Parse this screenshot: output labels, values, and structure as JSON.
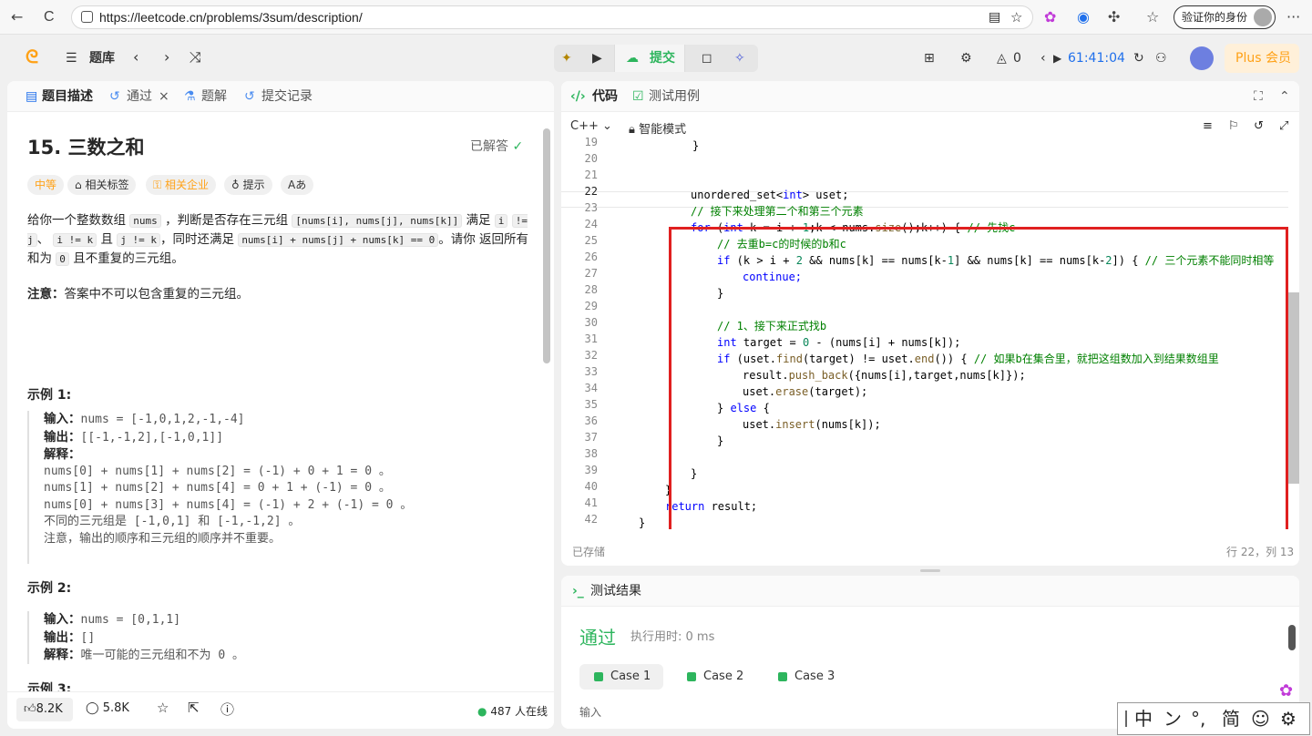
{
  "browser": {
    "url": "https://leetcode.cn/problems/3sum/description/",
    "verify_label": "验证你的身份",
    "back_icon": "←",
    "refresh_icon": "C",
    "more_icon": "···"
  },
  "header": {
    "problemset_label": "题库",
    "submit_label": "提交",
    "fire_count": "0",
    "timer": "61:41:04",
    "plus_label": "Plus 会员"
  },
  "left_tabs": [
    "题目描述",
    "通过",
    "题解",
    "提交记录"
  ],
  "problem": {
    "title": "15. 三数之和",
    "solved_label": "已解答",
    "difficulty": "中等",
    "tags_label": "相关标签",
    "company_label": "相关企业",
    "hint_label": "提示",
    "font_label": "Aあ",
    "desc_l1_a": "给你一个整数数组",
    "desc_code_nums": "nums",
    "desc_l1_b": "，判断是否存在三元组",
    "desc_code_triplet": "[nums[i], nums[j], nums[k]]",
    "desc_l1_c": "满足",
    "desc_code_i": "i",
    "desc_code_ij": "!= j",
    "desc_sep1": "、",
    "desc_code_ik": "i != k",
    "desc_and": "且",
    "desc_code_jk": "j != k",
    "desc_l2_b": "，同时还满足",
    "desc_code_sum": "nums[i] + nums[j] + nums[k] == 0",
    "desc_l2_c": "。请你",
    "desc_l3_a": "返回所有和为",
    "desc_code_zero": "0",
    "desc_l3_b": "且不重复的三元组。",
    "note_label": "注意：",
    "note_text": "答案中不可以包含重复的三元组。",
    "example1_title": "示例 1:",
    "example1": {
      "input_label": "输入：",
      "input": "nums = [-1,0,1,2,-1,-4]",
      "output_label": "输出：",
      "output": "[[-1,-1,2],[-1,0,1]]",
      "explain_label": "解释：",
      "lines": [
        "nums[0] + nums[1] + nums[2] = (-1) + 0 + 1 = 0 。",
        "nums[1] + nums[2] + nums[4] = 0 + 1 + (-1) = 0 。",
        "nums[0] + nums[3] + nums[4] = (-1) + 2 + (-1) = 0 。",
        "不同的三元组是 [-1,0,1] 和 [-1,-1,2] 。",
        "注意，输出的顺序和三元组的顺序并不重要。"
      ]
    },
    "example2_title": "示例 2:",
    "example2": {
      "input_label": "输入：",
      "input": "nums = [0,1,1]",
      "output_label": "输出：",
      "output": "[]",
      "explain_label": "解释：",
      "explain": "唯一可能的三元组和不为 0 。"
    },
    "example3_title": "示例 3:"
  },
  "left_footer": {
    "likes": "8.2K",
    "comments": "5.8K",
    "online": "487 人在线"
  },
  "code_tabs": [
    "代码",
    "测试用例"
  ],
  "editor": {
    "language": "C++",
    "mode_label": "智能模式",
    "saved_label": "已存储",
    "position_label": "行 22，列 13",
    "line_numbers": [
      "19",
      "20",
      "21",
      "22",
      "23",
      "24",
      "25",
      "26",
      "27",
      "28",
      "29",
      "30",
      "31",
      "32",
      "33",
      "34",
      "35",
      "36",
      "37",
      "38",
      "39",
      "40",
      "41",
      "42"
    ]
  },
  "result": {
    "title": "测试结果",
    "status": "通过",
    "runtime": "执行用时: 0 ms",
    "cases": [
      "Case 1",
      "Case 2",
      "Case 3"
    ],
    "input_label": "输入"
  },
  "ime": {
    "chars": [
      "中",
      "ン",
      "°,",
      "简",
      "☺",
      "⚙"
    ]
  },
  "colors": {
    "accent_green": "#2db55d",
    "difficulty_orange": "#ffa116",
    "red_box": "#e02020",
    "keyword": "#0000ff",
    "comment": "#008000"
  }
}
